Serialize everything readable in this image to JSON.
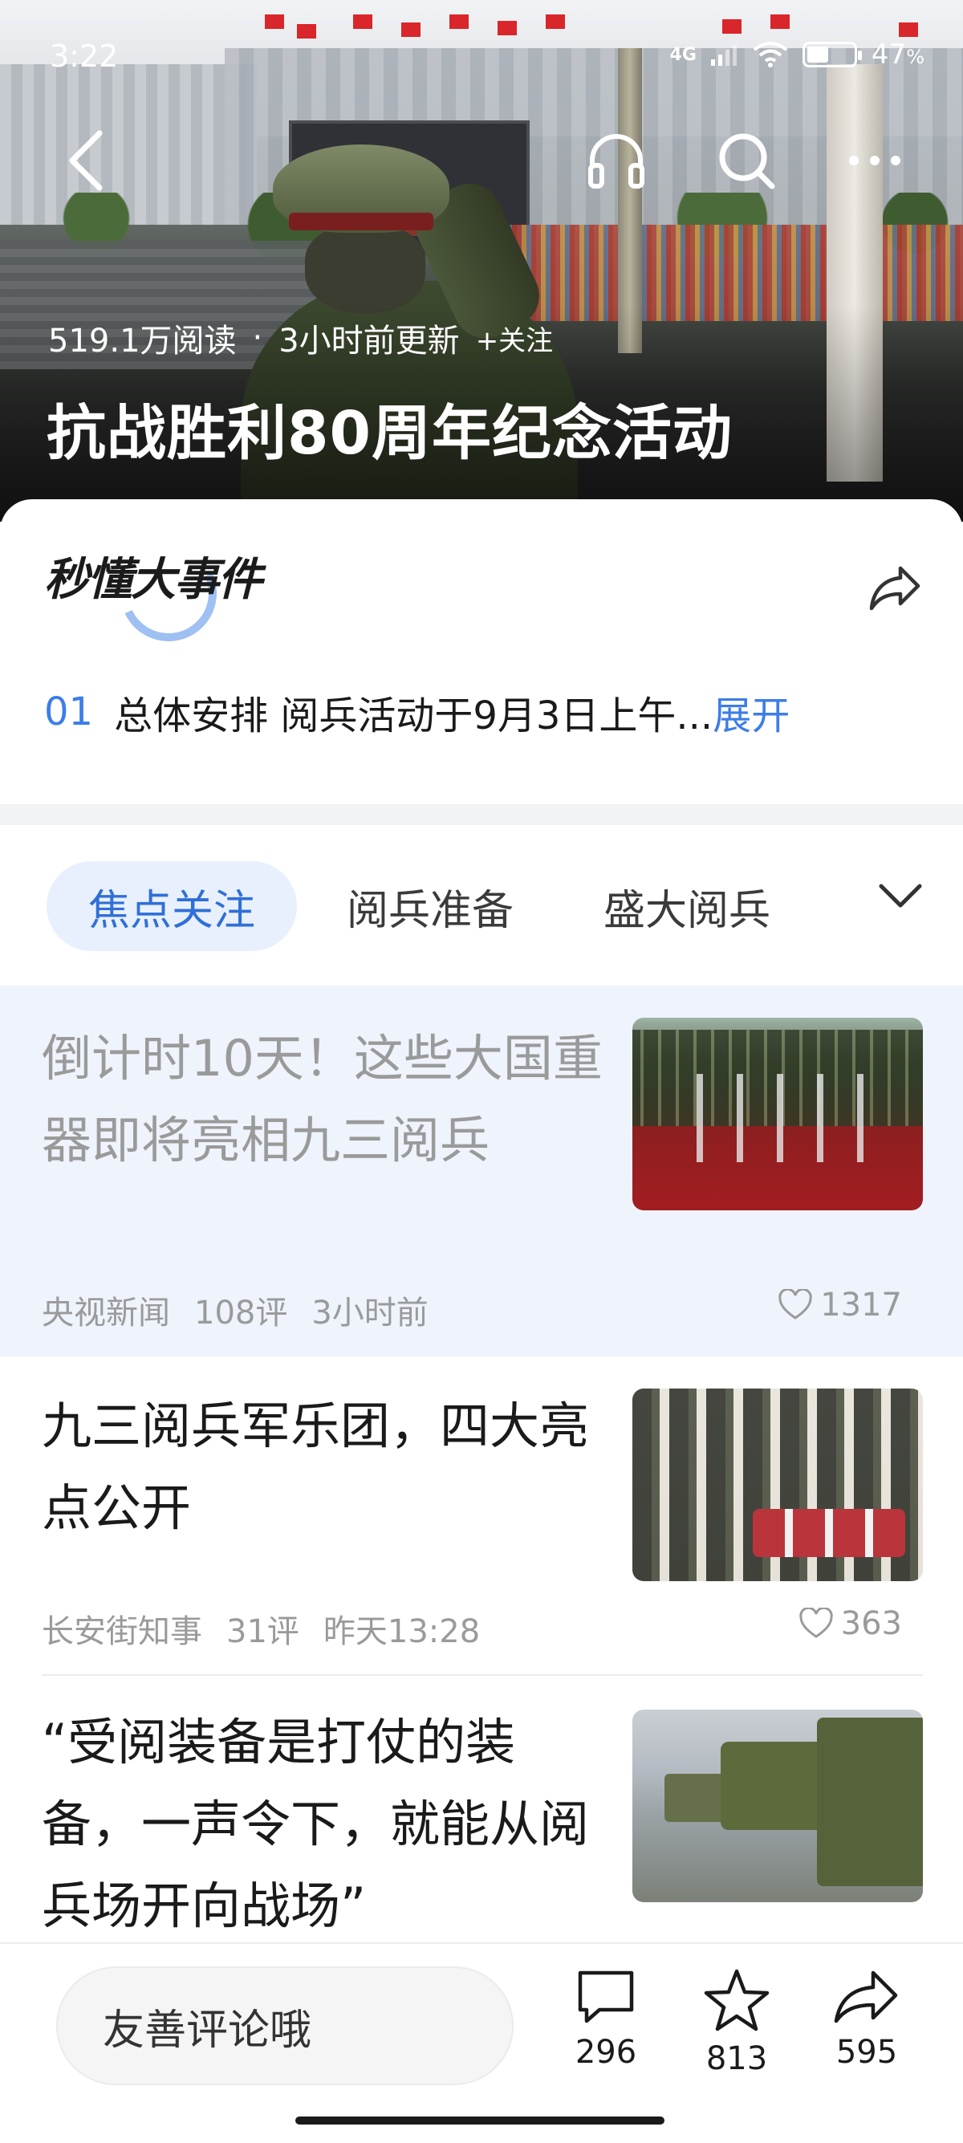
{
  "status_bar": {
    "time": "3:22",
    "network": "4G",
    "battery": "47",
    "battery_unit": "%",
    "battery_level": 0.47
  },
  "hero": {
    "reads": "519.1万阅读",
    "dot": "·",
    "updated": "3小时前更新",
    "follow": "+关注",
    "title": "抗战胜利80周年纪念活动"
  },
  "nav": {
    "back_icon": "chevron-left-icon",
    "listen_icon": "headphones-icon",
    "search_icon": "search-icon",
    "more_icon": "more-dots-icon"
  },
  "card": {
    "brand": "秒懂大事件",
    "summary_index": "01",
    "summary_text": "总体安排 阅兵活动于9月3日上午...",
    "expand": "展开"
  },
  "tabs": {
    "items": [
      "焦点关注",
      "阅兵准备",
      "盛大阅兵"
    ],
    "active": 0
  },
  "articles": [
    {
      "title": "倒计时10天！这些大国重器即将亮相九三阅兵",
      "source": "央视新闻",
      "comments": "108评",
      "time": "3小时前",
      "likes": "1317"
    },
    {
      "title": "九三阅兵军乐团，四大亮点公开",
      "source": "长安街知事",
      "comments": "31评",
      "time": "昨天13:28",
      "likes": "363"
    },
    {
      "title": "“受阅装备是打仗的装备，一声令下，就能从阅兵场开向战场”"
    }
  ],
  "bottom_bar": {
    "comment_placeholder": "友善评论哦",
    "comment_count": "296",
    "like_count": "813",
    "share_count": "595"
  },
  "colors": {
    "accent": "#3d7de8",
    "tab_active_bg": "#e8f0fd",
    "highlight_bg": "#eef3fc"
  }
}
